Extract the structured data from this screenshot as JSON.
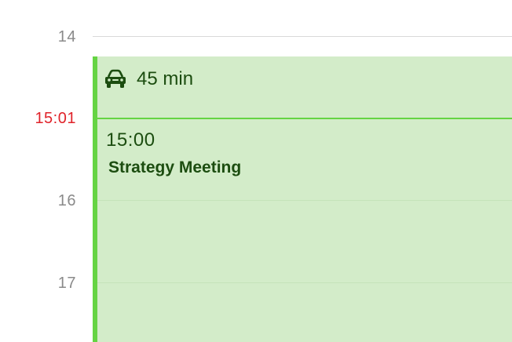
{
  "timeline": {
    "hours": [
      {
        "label": "14"
      },
      {
        "label": "16"
      },
      {
        "label": "17"
      }
    ],
    "current_time_label": "15:01"
  },
  "event": {
    "travel_time": "45 min",
    "start_time": "15:00",
    "title": "Strategy Meeting",
    "colors": {
      "accent": "#65d443",
      "fill": "#d3ecc9",
      "text": "#1c4d10",
      "current_time": "#e0232a"
    },
    "travel_icon": "car-icon"
  }
}
